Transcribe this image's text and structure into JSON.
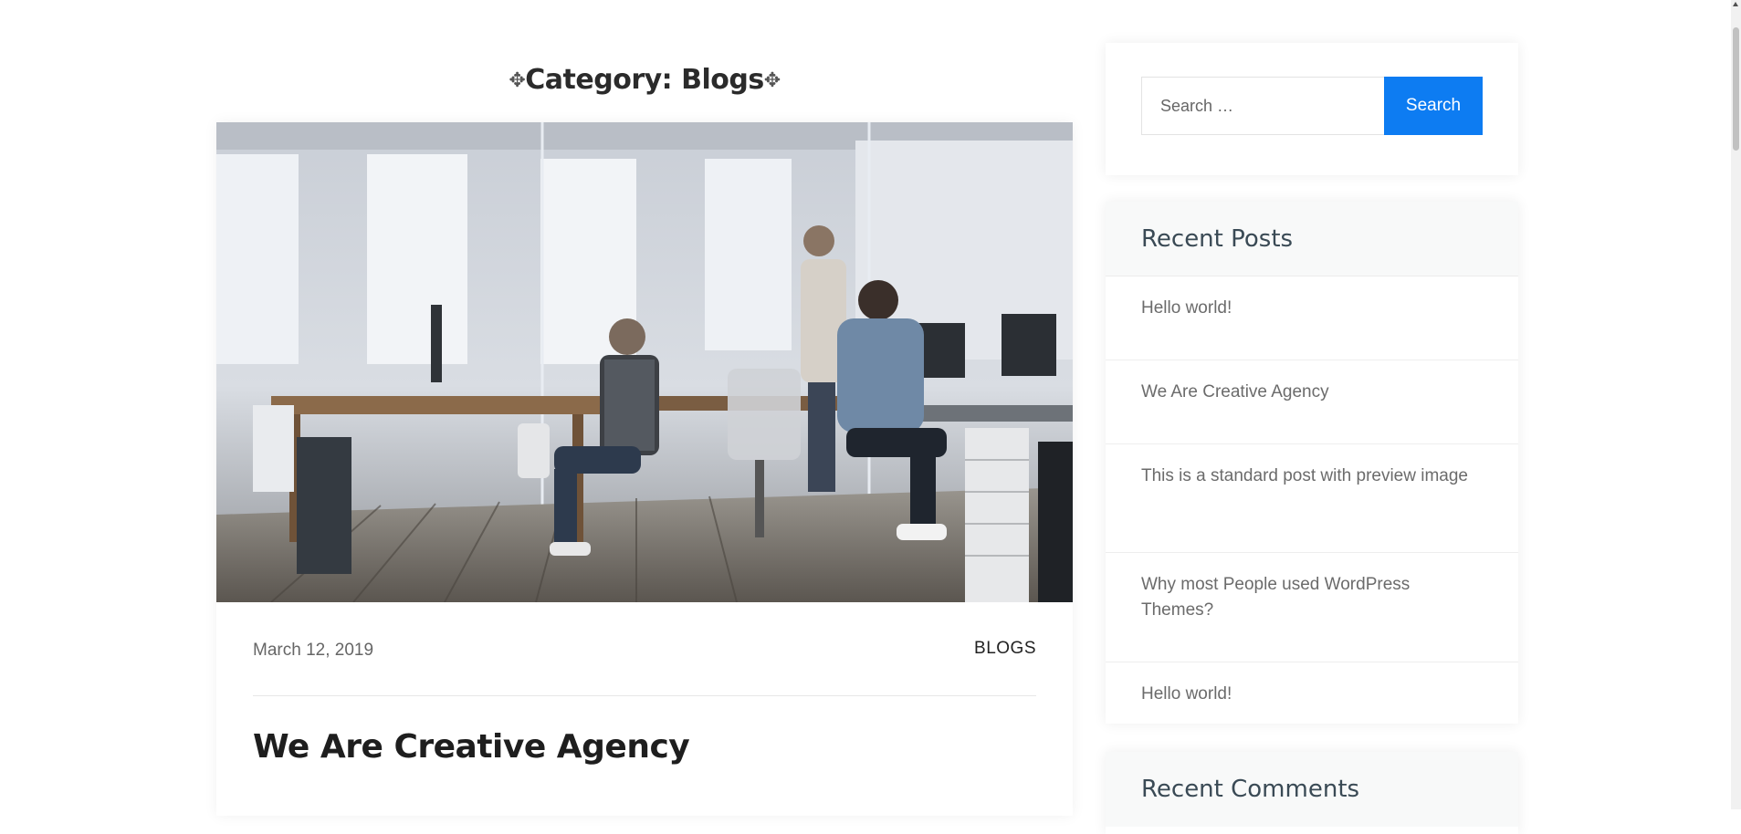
{
  "archive": {
    "title": "Category: Blogs",
    "move_glyph": "✥"
  },
  "post": {
    "image_alt": "Office team working at desks",
    "date": "March 12, 2019",
    "category": "BLOGS",
    "title": "We Are Creative Agency"
  },
  "search": {
    "placeholder": "Search …",
    "button_label": "Search"
  },
  "recent_posts": {
    "title": "Recent Posts",
    "items": [
      {
        "label": "Hello world!"
      },
      {
        "label": "We Are Creative Agency"
      },
      {
        "label": "This is a standard post with preview image"
      },
      {
        "label": "Why most People used WordPress Themes?"
      },
      {
        "label": "Hello world!"
      }
    ]
  },
  "recent_comments": {
    "title": "Recent Comments"
  },
  "colors": {
    "accent": "#0d7cf2",
    "title_text": "#1e1e1e",
    "muted_text": "#6b6b6b"
  }
}
